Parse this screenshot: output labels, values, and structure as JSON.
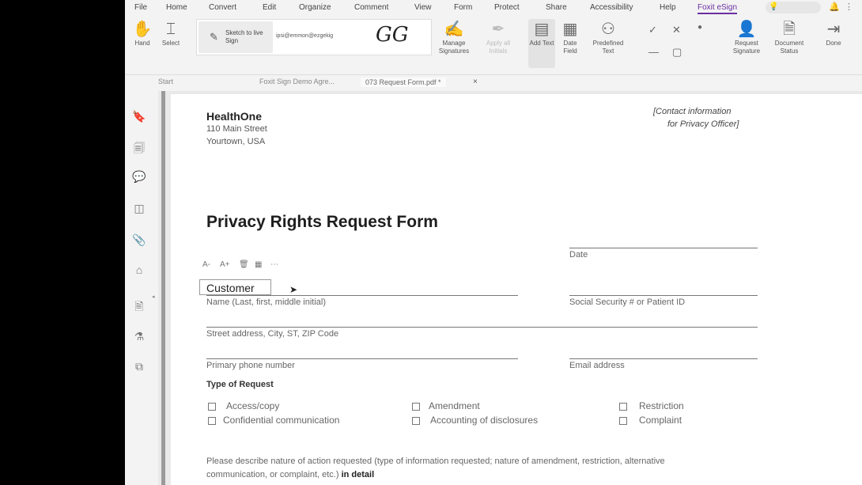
{
  "menu": {
    "items": [
      "File",
      "Home",
      "Convert",
      "Edit",
      "Organize",
      "Comment",
      "View",
      "Form",
      "Protect",
      "Share",
      "Accessibility",
      "Help",
      "Foxit eSign"
    ],
    "active": "Foxit eSign",
    "accent": "#6b2fa0"
  },
  "ribbon": {
    "hand_label": "Hand",
    "select_label": "Select",
    "sketch_label": "Sketch to live Sign",
    "signer_email": "ipsi@emmon@ezgekig",
    "initials": "GG",
    "manage_label": "Manage Signatures",
    "apply_label": "Apply all Initials",
    "add_text_label": "Add Text",
    "date_label": "Date Field",
    "predefined_label": "Predefined Text",
    "request_label": "Request Signature",
    "doc_status_label": "Document Status",
    "done_label": "Done",
    "check_glyph": "✓",
    "cross_glyph": "✕",
    "dot_glyph": "●",
    "line_glyph": "—",
    "box_glyph": "▢"
  },
  "tabs": {
    "start_label": "Start",
    "tab1_label": "Foxit Sign Demo Agre...",
    "tab2_label": "073 Request Form.pdf *",
    "close_glyph": "×"
  },
  "document": {
    "org_name": "HealthOne",
    "org_addr1": "110 Main Street",
    "org_addr2": "Yourtown, USA",
    "contact1": "[Contact information",
    "contact2": "for Privacy Officer]",
    "title": "Privacy Rights Request Form",
    "date_label": "Date",
    "customer_value": "Customer",
    "name_label": "Name (Last, first, middle initial)",
    "ssn_label": "Social Security # or Patient ID",
    "address_label": "Street address, City, ST, ZIP Code",
    "phone_label": "Primary phone number",
    "email_label": "Email address",
    "type_heading": "Type of Request",
    "options": [
      "Access/copy",
      "Amendment",
      "Restriction",
      "Confidential communication",
      "Accounting of disclosures",
      "Complaint"
    ],
    "describe_line1": "Please describe nature of action requested (type of information requested; nature of amendment, restriction, alternative",
    "describe_line2": "communication, or complaint, etc.)",
    "describe_bold": "in detail"
  },
  "format_bar": {
    "grow_label": "A+",
    "shrink_label": "A-",
    "delete_glyph": "🗑",
    "more_glyph": "⋯"
  }
}
